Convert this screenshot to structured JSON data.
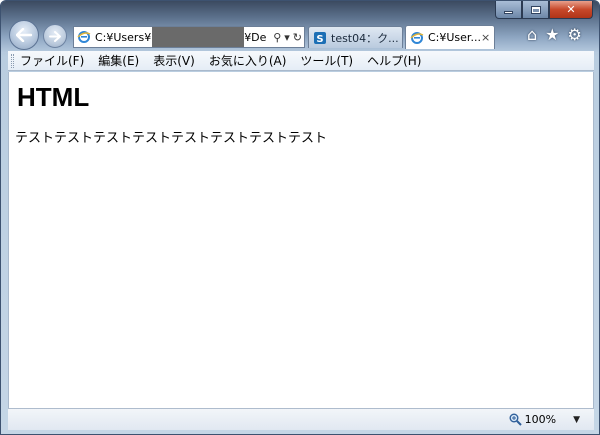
{
  "window": {
    "caption_buttons": {
      "minimize": "minimize-icon",
      "maximize": "maximize-icon",
      "close": "close-icon"
    }
  },
  "nav": {
    "back_icon": "back-arrow-icon",
    "forward_icon": "forward-arrow-icon"
  },
  "address": {
    "value_start": "C:¥Users¥",
    "value_end": "¥De",
    "search_icon": "search-icon",
    "dropdown_icon": "chevron-down-icon",
    "refresh_icon": "refresh-icon"
  },
  "tabs": [
    {
      "label": "test04：ク...",
      "active": false,
      "icon": "sharepoint-icon"
    },
    {
      "label": "C:¥User...",
      "active": true,
      "icon": "ie-icon",
      "close": "×"
    }
  ],
  "toolbar": {
    "home_icon": "home-icon",
    "favorites_icon": "star-icon",
    "tools_icon": "gear-icon"
  },
  "menu": {
    "items": [
      "ファイル(F)",
      "編集(E)",
      "表示(V)",
      "お気に入り(A)",
      "ツール(T)",
      "ヘルプ(H)"
    ]
  },
  "page": {
    "heading": "HTML",
    "text": "テストテストテストテストテストテストテストテスト"
  },
  "status": {
    "zoom": "100%",
    "zoom_icon": "zoom-icon"
  },
  "colors": {
    "accent": "#3b5a86",
    "close_button": "#c7482a"
  }
}
